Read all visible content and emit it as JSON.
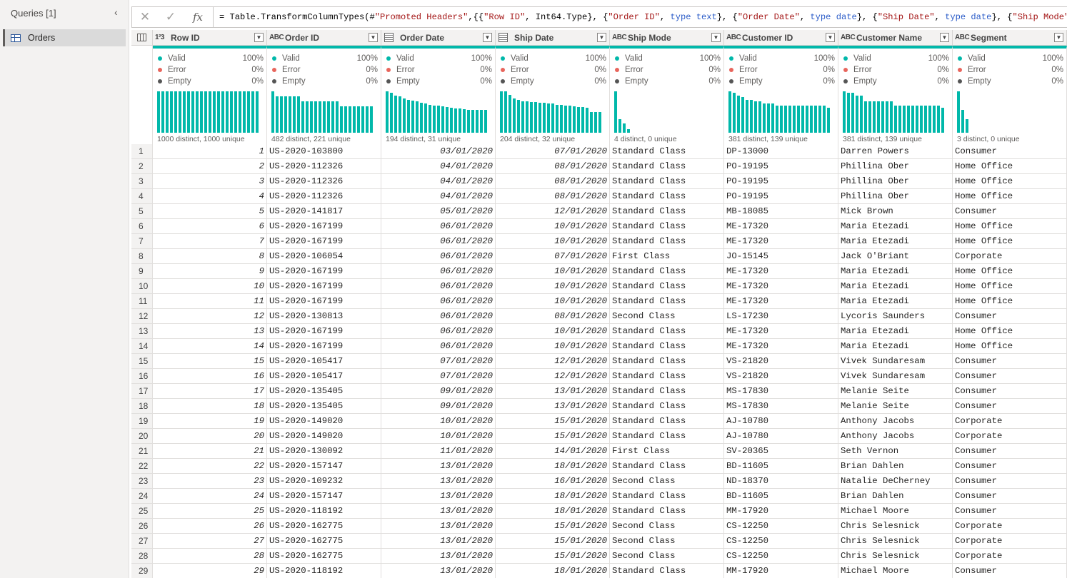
{
  "queries_pane": {
    "title": "Queries [1]",
    "collapse_icon": "chevron-left-icon",
    "items": [
      {
        "label": "Orders",
        "icon": "table-icon"
      }
    ]
  },
  "formula_bar": {
    "cancel_icon": "close-icon",
    "confirm_icon": "check-icon",
    "fx_label": "fx",
    "formula": "= Table.TransformColumnTypes(#\"Promoted Headers\",{{\"Row ID\", Int64.Type}, {\"Order ID\", type text}, {\"Order Date\", type date}, {\"Ship Date\", type date}, {\"Ship Mode\", type text}, {\"",
    "tokens": [
      {
        "t": "= Table.TransformColumnTypes(#",
        "c": ""
      },
      {
        "t": "\"Promoted Headers\"",
        "c": "sr"
      },
      {
        "t": ",{{",
        "c": ""
      },
      {
        "t": "\"Row ID\"",
        "c": "sr"
      },
      {
        "t": ", Int64.Type}, {",
        "c": ""
      },
      {
        "t": "\"Order ID\"",
        "c": "sr"
      },
      {
        "t": ", ",
        "c": ""
      },
      {
        "t": "type text",
        "c": "kw"
      },
      {
        "t": "}, {",
        "c": ""
      },
      {
        "t": "\"Order Date\"",
        "c": "sr"
      },
      {
        "t": ", ",
        "c": ""
      },
      {
        "t": "type date",
        "c": "kw"
      },
      {
        "t": "}, {",
        "c": ""
      },
      {
        "t": "\"Ship Date\"",
        "c": "sr"
      },
      {
        "t": ", ",
        "c": ""
      },
      {
        "t": "type date",
        "c": "kw"
      },
      {
        "t": "}, {",
        "c": ""
      },
      {
        "t": "\"Ship Mode\"",
        "c": "sr"
      },
      {
        "t": ", ",
        "c": ""
      },
      {
        "t": "type text",
        "c": "kw"
      },
      {
        "t": "}, {\"",
        "c": ""
      }
    ]
  },
  "colors": {
    "valid": "#01b8aa",
    "error": "#e8655c",
    "empty": "#555555",
    "accent": "#01b8aa"
  },
  "profile_labels": {
    "valid": "Valid",
    "error": "Error",
    "empty": "Empty"
  },
  "columns": [
    {
      "name": "Row ID",
      "type_label": "1²3",
      "kind": "num",
      "valid": "100%",
      "error": "0%",
      "empty": "0%",
      "stat": "1000 distinct, 1000 unique",
      "bars": [
        1,
        1,
        1,
        1,
        1,
        1,
        1,
        1,
        1,
        1,
        1,
        1,
        1,
        1,
        1,
        1,
        1,
        1,
        1,
        1,
        1,
        1,
        1,
        1
      ]
    },
    {
      "name": "Order ID",
      "type_label": "ABC",
      "kind": "text",
      "valid": "100%",
      "error": "0%",
      "empty": "0%",
      "stat": "482 distinct, 221 unique",
      "bars": [
        1,
        0.88,
        0.88,
        0.88,
        0.88,
        0.88,
        0.88,
        0.75,
        0.75,
        0.75,
        0.75,
        0.75,
        0.75,
        0.75,
        0.75,
        0.75,
        0.63,
        0.63,
        0.63,
        0.63,
        0.63,
        0.63,
        0.63,
        0.63
      ]
    },
    {
      "name": "Order Date",
      "type_label": "cal",
      "kind": "date",
      "valid": "100%",
      "error": "0%",
      "empty": "0%",
      "stat": "194 distinct, 31 unique",
      "bars": [
        1,
        0.97,
        0.9,
        0.88,
        0.83,
        0.8,
        0.78,
        0.75,
        0.73,
        0.7,
        0.68,
        0.66,
        0.65,
        0.63,
        0.62,
        0.6,
        0.59,
        0.58,
        0.57,
        0.56,
        0.56,
        0.55,
        0.55,
        0.55
      ]
    },
    {
      "name": "Ship Date",
      "type_label": "cal",
      "kind": "date",
      "valid": "100%",
      "error": "0%",
      "empty": "0%",
      "stat": "204 distinct, 32 unique",
      "bars": [
        1,
        1,
        0.92,
        0.82,
        0.8,
        0.76,
        0.76,
        0.74,
        0.74,
        0.72,
        0.72,
        0.7,
        0.7,
        0.68,
        0.68,
        0.66,
        0.66,
        0.64,
        0.62,
        0.62,
        0.6,
        0.5,
        0.5,
        0.5
      ]
    },
    {
      "name": "Ship Mode",
      "type_label": "ABC",
      "kind": "text",
      "valid": "100%",
      "error": "0%",
      "empty": "0%",
      "stat": "4 distinct, 0 unique",
      "bars": [
        1,
        0.32,
        0.22,
        0.08
      ]
    },
    {
      "name": "Customer ID",
      "type_label": "ABC",
      "kind": "text",
      "valid": "100%",
      "error": "0%",
      "empty": "0%",
      "stat": "381 distinct, 139 unique",
      "bars": [
        1,
        0.97,
        0.9,
        0.86,
        0.8,
        0.8,
        0.75,
        0.75,
        0.7,
        0.7,
        0.7,
        0.66,
        0.66,
        0.66,
        0.66,
        0.66,
        0.66,
        0.66,
        0.66,
        0.66,
        0.66,
        0.66,
        0.66,
        0.6
      ]
    },
    {
      "name": "Customer Name",
      "type_label": "ABC",
      "kind": "text",
      "valid": "100%",
      "error": "0%",
      "empty": "0%",
      "stat": "381 distinct, 139 unique",
      "bars": [
        1,
        0.97,
        0.97,
        0.9,
        0.9,
        0.76,
        0.76,
        0.76,
        0.76,
        0.76,
        0.76,
        0.76,
        0.66,
        0.66,
        0.66,
        0.66,
        0.66,
        0.66,
        0.66,
        0.66,
        0.66,
        0.66,
        0.66,
        0.6
      ]
    },
    {
      "name": "Segment",
      "type_label": "ABC",
      "kind": "text",
      "valid": "100%",
      "error": "0%",
      "empty": "0%",
      "stat": "3 distinct, 0 unique",
      "bars": [
        1,
        0.55,
        0.32
      ]
    }
  ],
  "rows": [
    [
      "1",
      "US-2020-103800",
      "03/01/2020",
      "07/01/2020",
      "Standard Class",
      "DP-13000",
      "Darren Powers",
      "Consumer"
    ],
    [
      "2",
      "US-2020-112326",
      "04/01/2020",
      "08/01/2020",
      "Standard Class",
      "PO-19195",
      "Phillina Ober",
      "Home Office"
    ],
    [
      "3",
      "US-2020-112326",
      "04/01/2020",
      "08/01/2020",
      "Standard Class",
      "PO-19195",
      "Phillina Ober",
      "Home Office"
    ],
    [
      "4",
      "US-2020-112326",
      "04/01/2020",
      "08/01/2020",
      "Standard Class",
      "PO-19195",
      "Phillina Ober",
      "Home Office"
    ],
    [
      "5",
      "US-2020-141817",
      "05/01/2020",
      "12/01/2020",
      "Standard Class",
      "MB-18085",
      "Mick Brown",
      "Consumer"
    ],
    [
      "6",
      "US-2020-167199",
      "06/01/2020",
      "10/01/2020",
      "Standard Class",
      "ME-17320",
      "Maria Etezadi",
      "Home Office"
    ],
    [
      "7",
      "US-2020-167199",
      "06/01/2020",
      "10/01/2020",
      "Standard Class",
      "ME-17320",
      "Maria Etezadi",
      "Home Office"
    ],
    [
      "8",
      "US-2020-106054",
      "06/01/2020",
      "07/01/2020",
      "First Class",
      "JO-15145",
      "Jack O'Briant",
      "Corporate"
    ],
    [
      "9",
      "US-2020-167199",
      "06/01/2020",
      "10/01/2020",
      "Standard Class",
      "ME-17320",
      "Maria Etezadi",
      "Home Office"
    ],
    [
      "10",
      "US-2020-167199",
      "06/01/2020",
      "10/01/2020",
      "Standard Class",
      "ME-17320",
      "Maria Etezadi",
      "Home Office"
    ],
    [
      "11",
      "US-2020-167199",
      "06/01/2020",
      "10/01/2020",
      "Standard Class",
      "ME-17320",
      "Maria Etezadi",
      "Home Office"
    ],
    [
      "12",
      "US-2020-130813",
      "06/01/2020",
      "08/01/2020",
      "Second Class",
      "LS-17230",
      "Lycoris Saunders",
      "Consumer"
    ],
    [
      "13",
      "US-2020-167199",
      "06/01/2020",
      "10/01/2020",
      "Standard Class",
      "ME-17320",
      "Maria Etezadi",
      "Home Office"
    ],
    [
      "14",
      "US-2020-167199",
      "06/01/2020",
      "10/01/2020",
      "Standard Class",
      "ME-17320",
      "Maria Etezadi",
      "Home Office"
    ],
    [
      "15",
      "US-2020-105417",
      "07/01/2020",
      "12/01/2020",
      "Standard Class",
      "VS-21820",
      "Vivek Sundaresam",
      "Consumer"
    ],
    [
      "16",
      "US-2020-105417",
      "07/01/2020",
      "12/01/2020",
      "Standard Class",
      "VS-21820",
      "Vivek Sundaresam",
      "Consumer"
    ],
    [
      "17",
      "US-2020-135405",
      "09/01/2020",
      "13/01/2020",
      "Standard Class",
      "MS-17830",
      "Melanie Seite",
      "Consumer"
    ],
    [
      "18",
      "US-2020-135405",
      "09/01/2020",
      "13/01/2020",
      "Standard Class",
      "MS-17830",
      "Melanie Seite",
      "Consumer"
    ],
    [
      "19",
      "US-2020-149020",
      "10/01/2020",
      "15/01/2020",
      "Standard Class",
      "AJ-10780",
      "Anthony Jacobs",
      "Corporate"
    ],
    [
      "20",
      "US-2020-149020",
      "10/01/2020",
      "15/01/2020",
      "Standard Class",
      "AJ-10780",
      "Anthony Jacobs",
      "Corporate"
    ],
    [
      "21",
      "US-2020-130092",
      "11/01/2020",
      "14/01/2020",
      "First Class",
      "SV-20365",
      "Seth Vernon",
      "Consumer"
    ],
    [
      "22",
      "US-2020-157147",
      "13/01/2020",
      "18/01/2020",
      "Standard Class",
      "BD-11605",
      "Brian Dahlen",
      "Consumer"
    ],
    [
      "23",
      "US-2020-109232",
      "13/01/2020",
      "16/01/2020",
      "Second Class",
      "ND-18370",
      "Natalie DeCherney",
      "Consumer"
    ],
    [
      "24",
      "US-2020-157147",
      "13/01/2020",
      "18/01/2020",
      "Standard Class",
      "BD-11605",
      "Brian Dahlen",
      "Consumer"
    ],
    [
      "25",
      "US-2020-118192",
      "13/01/2020",
      "18/01/2020",
      "Standard Class",
      "MM-17920",
      "Michael Moore",
      "Consumer"
    ],
    [
      "26",
      "US-2020-162775",
      "13/01/2020",
      "15/01/2020",
      "Second Class",
      "CS-12250",
      "Chris Selesnick",
      "Corporate"
    ],
    [
      "27",
      "US-2020-162775",
      "13/01/2020",
      "15/01/2020",
      "Second Class",
      "CS-12250",
      "Chris Selesnick",
      "Corporate"
    ],
    [
      "28",
      "US-2020-162775",
      "13/01/2020",
      "15/01/2020",
      "Second Class",
      "CS-12250",
      "Chris Selesnick",
      "Corporate"
    ],
    [
      "29",
      "US-2020-118192",
      "13/01/2020",
      "18/01/2020",
      "Standard Class",
      "MM-17920",
      "Michael Moore",
      "Consumer"
    ]
  ]
}
